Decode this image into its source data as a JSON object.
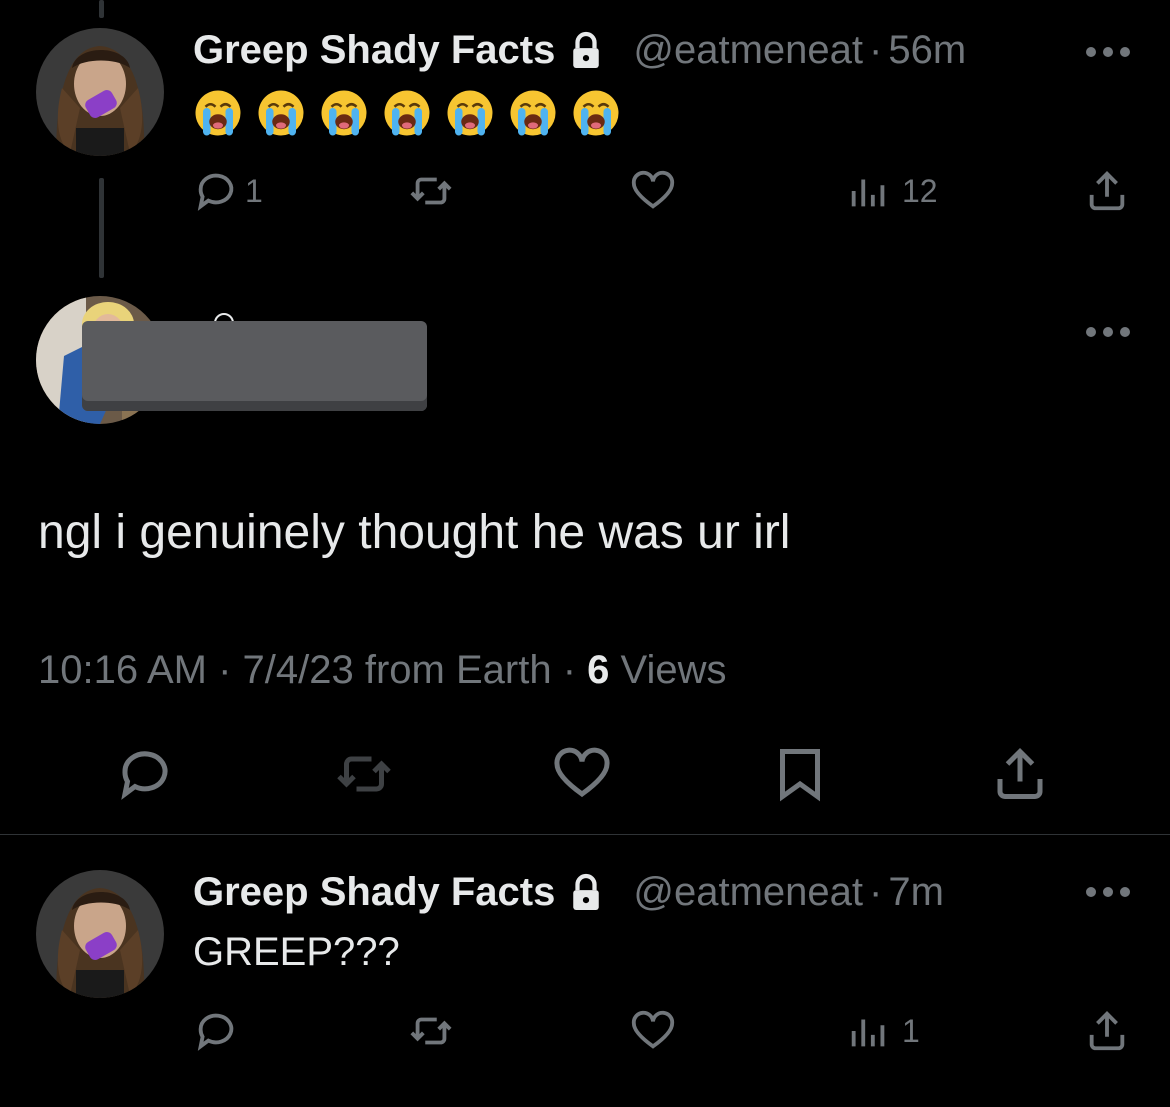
{
  "tweets": [
    {
      "display_name": "Greep Shady Facts",
      "handle": "@eatmeneat",
      "separator": "·",
      "time": "56m",
      "body_emojis": [
        "crying-face",
        "crying-face",
        "crying-face",
        "crying-face",
        "crying-face",
        "crying-face",
        "crying-face"
      ],
      "actions": {
        "reply_count": "1",
        "retweet_count": "",
        "like_count": "",
        "views_count": "12"
      }
    },
    {
      "display_name": "Greep Shady Facts",
      "handle": "@eatmeneat",
      "separator": "·",
      "time": "7m",
      "text": "GREEP???",
      "actions": {
        "reply_count": "",
        "retweet_count": "",
        "like_count": "",
        "views_count": "1"
      }
    }
  ],
  "focused_tweet": {
    "text": "ngl i genuinely thought he was ur irl",
    "timestamp": "10:16 AM · 7/4/23 from Earth · ",
    "views_count": "6",
    "views_label": " Views"
  },
  "icons": {
    "reply": "reply-icon",
    "retweet": "retweet-icon",
    "like": "heart-icon",
    "views": "views-icon",
    "share": "share-icon",
    "bookmark": "bookmark-icon",
    "more": "more-dots-icon",
    "lock": "lock-icon"
  },
  "colors": {
    "background": "#000000",
    "primary_text": "#e7e9ea",
    "secondary_text": "#71767b",
    "divider": "#2f3336"
  }
}
